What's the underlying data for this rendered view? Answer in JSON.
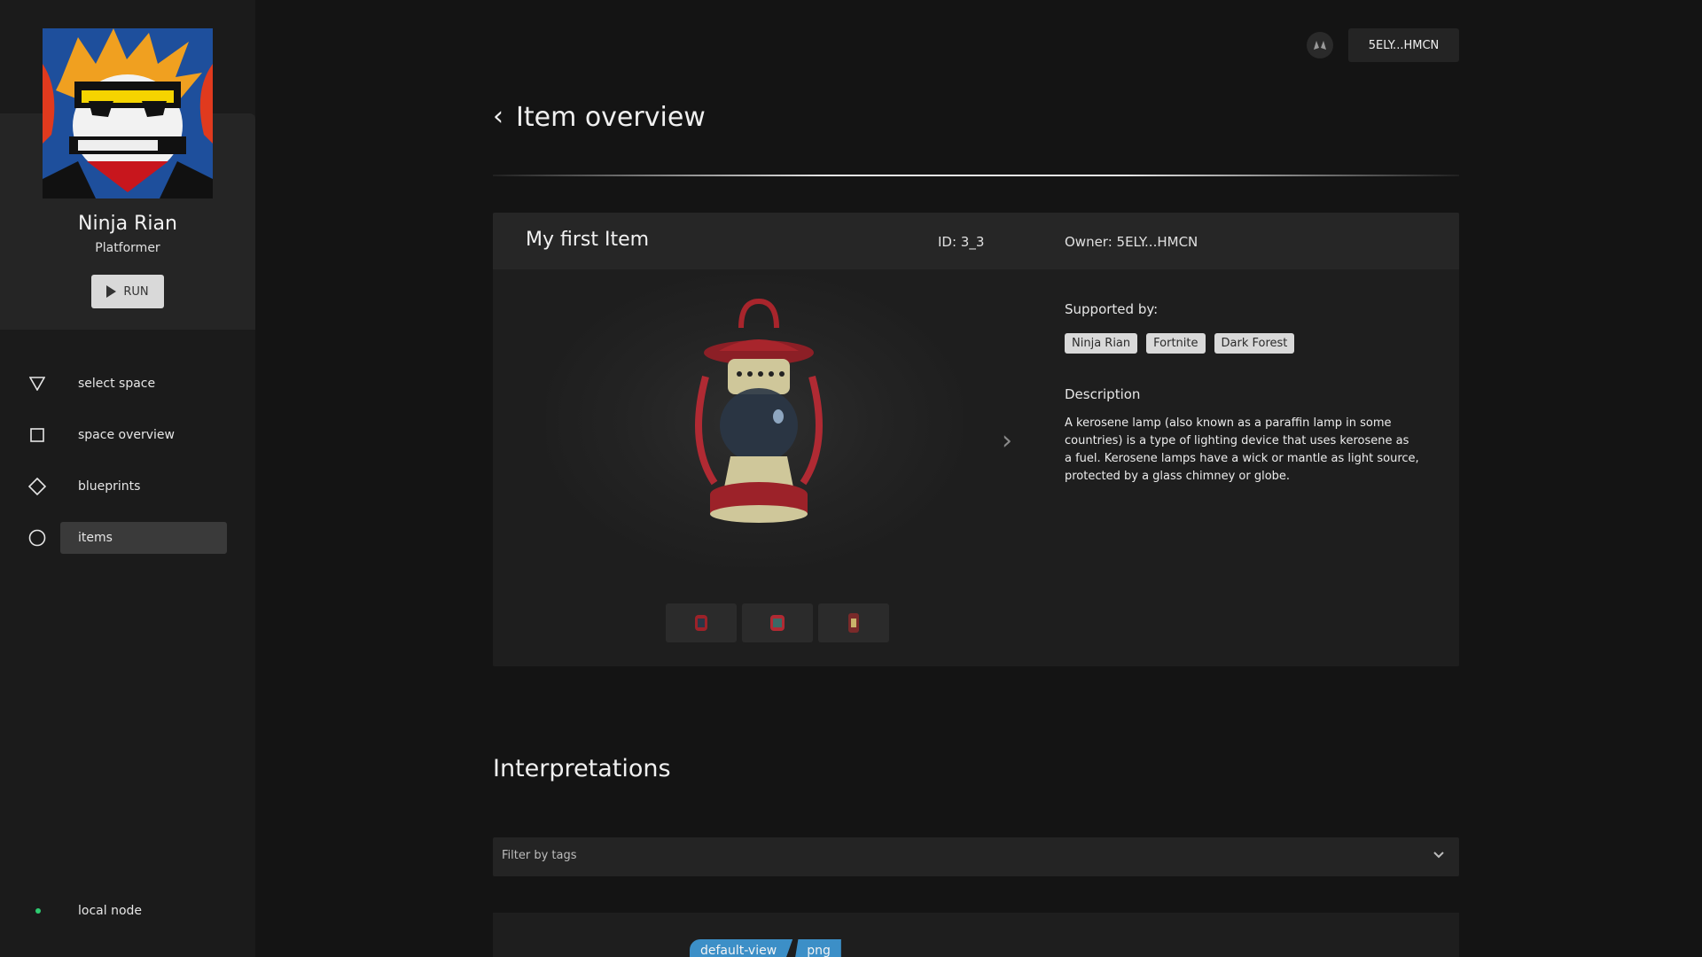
{
  "sidebar": {
    "game": {
      "name": "Ninja Rian",
      "genre": "Platformer",
      "run_label": "RUN"
    },
    "nav": [
      {
        "label": "select space",
        "icon": "triangle-down-icon"
      },
      {
        "label": "space overview",
        "icon": "square-icon"
      },
      {
        "label": "blueprints",
        "icon": "diamond-icon"
      },
      {
        "label": "items",
        "icon": "circle-icon",
        "active": true
      }
    ],
    "node": {
      "label": "local node",
      "status_color": "#2ecc71"
    }
  },
  "topbar": {
    "wallet": "5ELY...HMCN"
  },
  "page": {
    "title": "Item overview"
  },
  "item": {
    "name": "My first Item",
    "id_text": "ID: 3_3",
    "owner_text": "Owner:  5ELY...HMCN",
    "supported_label": "Supported by:",
    "supported_by": [
      "Ninja Rian",
      "Fortnite",
      "Dark Forest"
    ],
    "description_label": "Description",
    "description": "A kerosene lamp (also known as a paraffin lamp in some countries) is a type of lighting device that uses kerosene as a fuel. Kerosene lamps have a wick or mantle as light source, protected by a glass chimney or globe."
  },
  "interpretations": {
    "title": "Interpretations",
    "filter_placeholder": "Filter by tags",
    "first_tags": [
      "default-view",
      "png"
    ]
  },
  "colors": {
    "accent": "#3c8fc7",
    "background": "#141414",
    "card": "#1e1e1e"
  }
}
